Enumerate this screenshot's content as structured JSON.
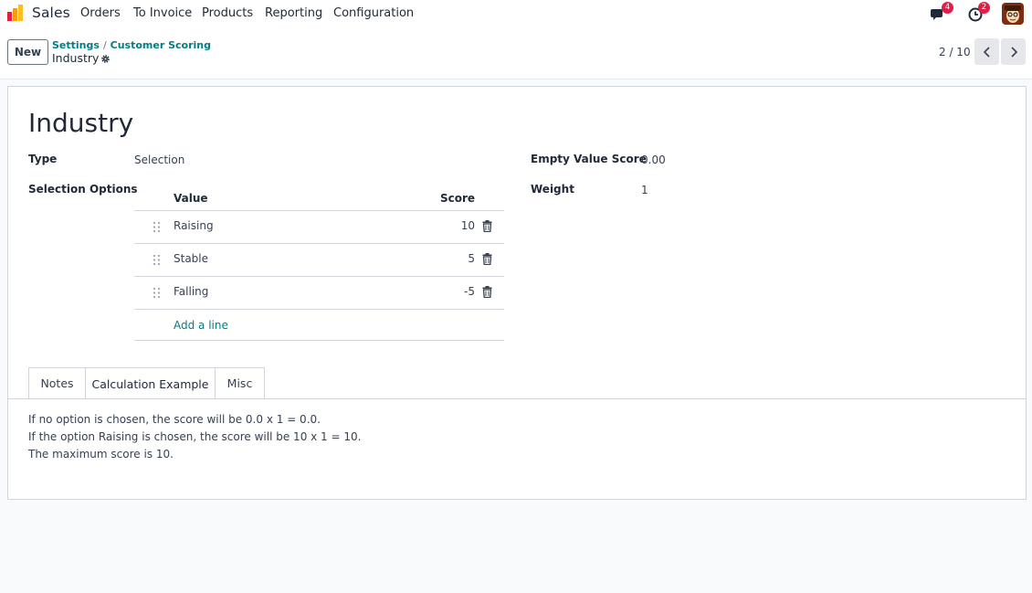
{
  "navbar": {
    "app_name": "Sales",
    "menu": [
      "Orders",
      "To Invoice",
      "Products",
      "Reporting",
      "Configuration"
    ],
    "messages_badge": "4",
    "activities_badge": "2",
    "accent_color": "#e11d48"
  },
  "control_panel": {
    "new_label": "New",
    "breadcrumb": [
      "Settings",
      "Customer Scoring"
    ],
    "breadcrumb_separator": "/",
    "record_title": "Industry",
    "pager": "2 / 10"
  },
  "form": {
    "title": "Industry",
    "type_label": "Type",
    "type_value": "Selection",
    "selection_options_label": "Selection Options",
    "empty_value_score_label": "Empty Value Score",
    "empty_value_score_value": "0.00",
    "weight_label": "Weight",
    "weight_value": "1",
    "options_table": {
      "columns": [
        "Value",
        "Score"
      ],
      "rows": [
        {
          "value": "Raising",
          "score": "10"
        },
        {
          "value": "Stable",
          "score": "5"
        },
        {
          "value": "Falling",
          "score": "-5"
        }
      ],
      "add_line": "Add a line"
    }
  },
  "tabs": {
    "items": [
      "Notes",
      "Calculation Example",
      "Misc"
    ],
    "active": "Calculation Example",
    "content": [
      "If no option is chosen, the score will be 0.0 x 1 = 0.0.",
      "If the option Raising is chosen, the score will be 10 x 1 = 10.",
      "The maximum score is 10."
    ]
  },
  "colors": {
    "link": "#017e84",
    "brand_orange": "#f59e0b",
    "brand_purple": "#7c3aed"
  }
}
